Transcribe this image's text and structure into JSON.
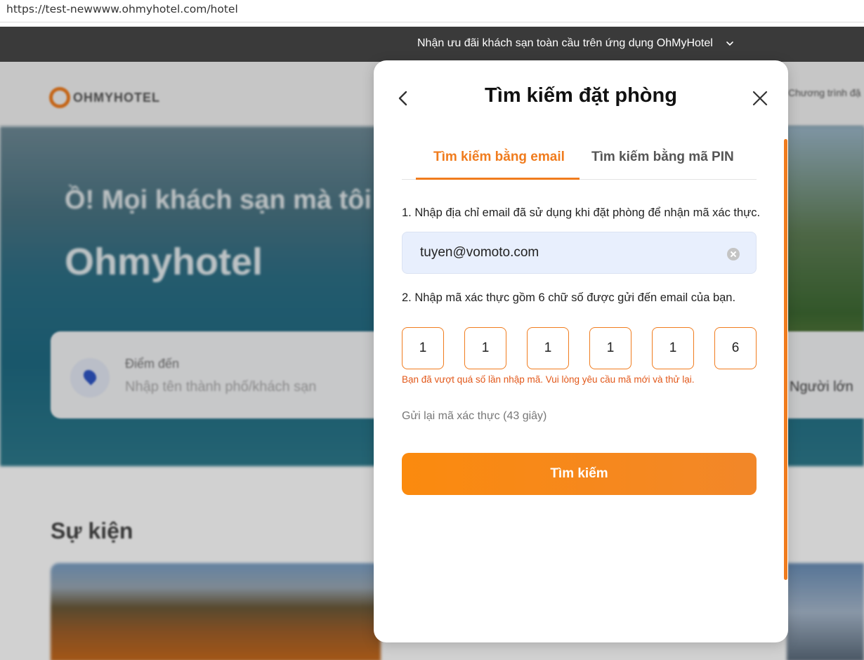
{
  "browser": {
    "url": "https://test-newwww.ohmyhotel.com/hotel"
  },
  "promo": {
    "text": "Nhận ưu đãi khách sạn toàn cầu trên ứng dụng OhMyHotel"
  },
  "background": {
    "logo_text": "OHMYHOTEL",
    "hero_line1": "Ồ! Mọi khách sạn mà tôi",
    "hero_line2": "Ohmyhotel",
    "destination_label": "Điểm đến",
    "destination_placeholder": "Nhập tên thành phố/khách sạn",
    "guests_label": "Người lớn",
    "events_heading": "Sự kiện",
    "top_right_partial": "Chương trình đặ"
  },
  "modal": {
    "title": "Tìm kiếm đặt phòng",
    "tabs": [
      {
        "label": "Tìm kiếm bằng email",
        "active": true
      },
      {
        "label": "Tìm kiếm bằng mã PIN",
        "active": false
      }
    ],
    "step1_text": "1. Nhập địa chỉ email đã sử dụng khi đặt phòng để nhận mã xác thực.",
    "email_value": "tuyen@vomoto.com",
    "step2_text": "2. Nhập mã xác thực gồm 6 chữ số được gửi đến email của bạn.",
    "code_digits": [
      "1",
      "1",
      "1",
      "1",
      "1",
      "6"
    ],
    "error_text": "Bạn đã vượt quá số lần nhập mã. Vui lòng yêu cầu mã mới và thử lại.",
    "resend_text": "Gửi lại mã xác thực (43  giây)",
    "search_button": "Tìm kiếm"
  },
  "colors": {
    "accent": "#f07c1e",
    "error": "#e2581a",
    "promo_bg": "#3a3a3a",
    "input_bg": "#e8effd"
  },
  "icons": [
    "chevron-down-icon",
    "back-icon",
    "close-icon",
    "clear-icon",
    "location-pin-icon"
  ]
}
